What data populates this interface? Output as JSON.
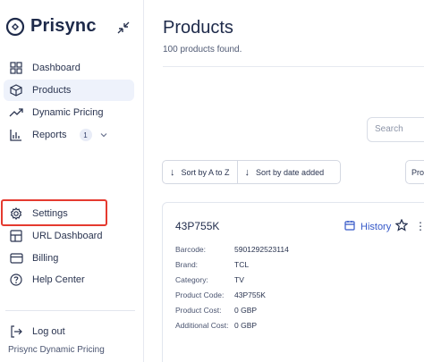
{
  "sidebar": {
    "brand": "Prisync",
    "items": [
      {
        "label": "Dashboard",
        "icon": "grid-icon"
      },
      {
        "label": "Products",
        "icon": "box-icon",
        "active": true
      },
      {
        "label": "Dynamic Pricing",
        "icon": "trend-icon"
      },
      {
        "label": "Reports",
        "icon": "bar-chart-icon",
        "badge": "1"
      },
      {
        "label": "Settings",
        "icon": "gear-icon",
        "highlighted": true
      },
      {
        "label": "URL Dashboard",
        "icon": "layout-icon"
      },
      {
        "label": "Billing",
        "icon": "credit-card-icon"
      },
      {
        "label": "Help Center",
        "icon": "help-icon"
      },
      {
        "label": "Log out",
        "icon": "logout-icon"
      }
    ],
    "footer": "Prisync Dynamic Pricing"
  },
  "main": {
    "title": "Products",
    "subtitle": "100 products found.",
    "search_placeholder": "Search",
    "sort_a_z": "Sort by A to Z",
    "sort_date": "Sort by date added",
    "pro_label": "Pro",
    "product": {
      "name": "43P755K",
      "history_label": "History",
      "fields": [
        {
          "k": "Barcode:",
          "v": "5901292523114"
        },
        {
          "k": "Brand:",
          "v": "TCL"
        },
        {
          "k": "Category:",
          "v": "TV"
        },
        {
          "k": "Product Code:",
          "v": "43P755K"
        },
        {
          "k": "Product Cost:",
          "v": "0 GBP"
        },
        {
          "k": "Additional Cost:",
          "v": "0 GBP"
        }
      ]
    }
  },
  "colors": {
    "accent": "#3558c8",
    "highlight": "#e53a2f",
    "active_bg": "#eef2fb"
  }
}
